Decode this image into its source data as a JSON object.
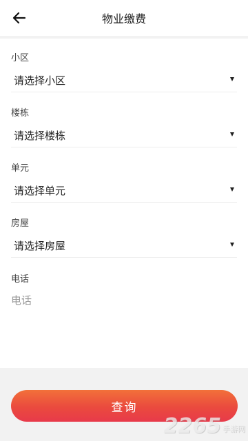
{
  "header": {
    "title": "物业缴费",
    "back_icon": "arrow-left-icon"
  },
  "form": {
    "community": {
      "label": "小区",
      "value": "请选择小区"
    },
    "building": {
      "label": "楼栋",
      "value": "请选择楼栋"
    },
    "unit": {
      "label": "单元",
      "value": "请选择单元"
    },
    "house": {
      "label": "房屋",
      "value": "请选择房屋"
    },
    "phone": {
      "label": "电话",
      "placeholder": "电话",
      "value": ""
    }
  },
  "footer": {
    "query_label": "查询"
  },
  "watermark": {
    "number": "2265",
    "text": "手游网"
  },
  "colors": {
    "button_gradient_start": "#f2703a",
    "button_gradient_end": "#e83a4a",
    "background": "#f2f2f2"
  }
}
